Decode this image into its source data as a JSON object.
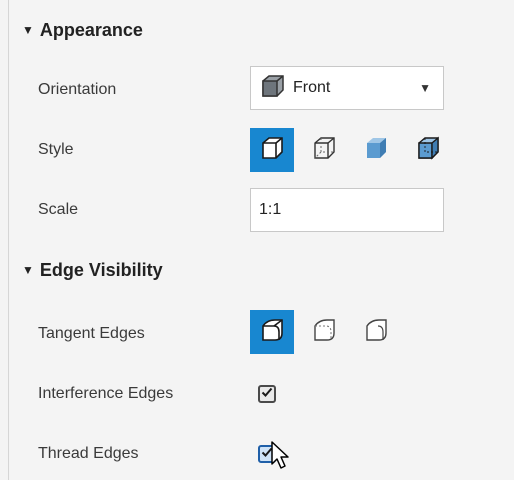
{
  "appearance": {
    "header": "Appearance",
    "orientation_label": "Orientation",
    "orientation_value": "Front",
    "style_label": "Style",
    "scale_label": "Scale",
    "scale_value": "1:1"
  },
  "edge_visibility": {
    "header": "Edge Visibility",
    "tangent_label": "Tangent Edges",
    "interference_label": "Interference Edges",
    "thread_label": "Thread Edges",
    "interference_checked": true,
    "thread_checked": true
  },
  "colors": {
    "accent": "#1887d0",
    "panel_bg": "#f4f4f4",
    "cube_face": "#7fb3dc"
  },
  "icons": {
    "orientation": "cube-front-icon",
    "styles": [
      "shaded-with-edges-icon",
      "wireframe-hidden-lines-icon",
      "shaded-icon",
      "shaded-visible-edges-icon"
    ],
    "tangent": [
      "tangent-solid-icon",
      "tangent-phantom-icon",
      "tangent-off-icon"
    ]
  }
}
